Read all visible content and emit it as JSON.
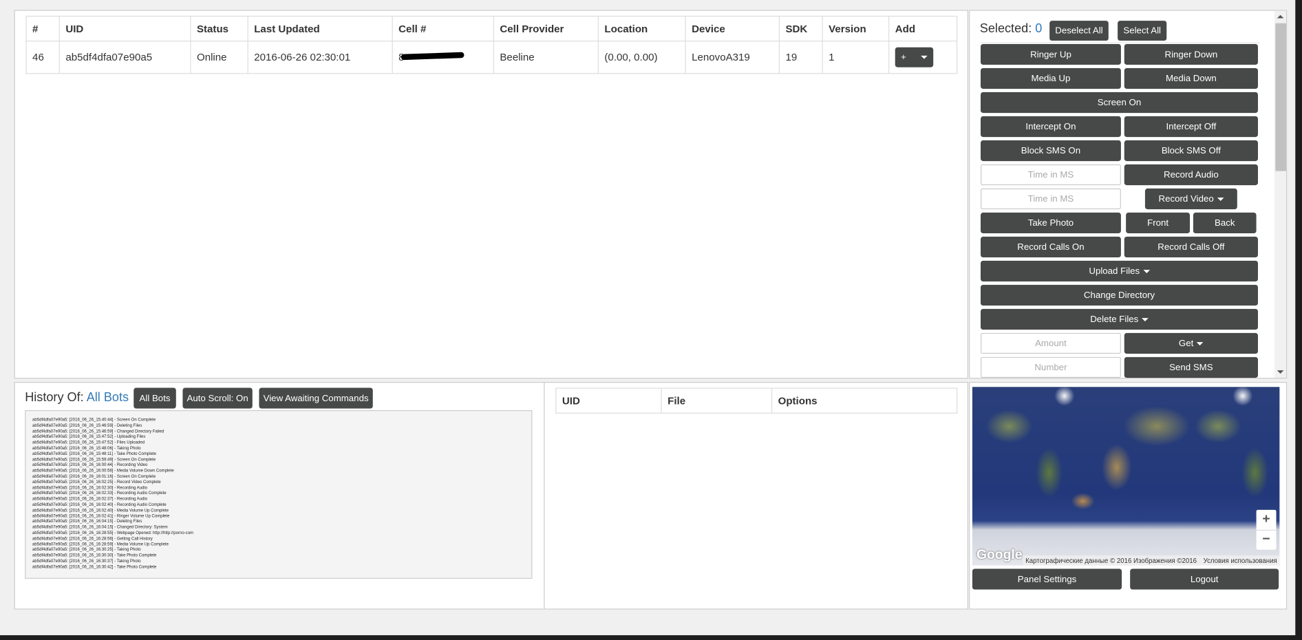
{
  "bots_table": {
    "headers": [
      "#",
      "UID",
      "Status",
      "Last Updated",
      "Cell #",
      "Cell Provider",
      "Location",
      "Device",
      "SDK",
      "Version",
      "Add"
    ],
    "rows": [
      {
        "num": "46",
        "uid": "ab5df4dfa07e90a5",
        "status": "Online",
        "last_updated": "2016-06-26 02:30:01",
        "cell": "8",
        "provider": "Beeline",
        "location": "(0.00, 0.00)",
        "device": "LenovoA319",
        "sdk": "19",
        "version": "1",
        "add": "+"
      }
    ]
  },
  "controls": {
    "selected_label": "Selected:",
    "selected_count": "0",
    "deselect_all": "Deselect All",
    "select_all": "Select All",
    "ringer_up": "Ringer Up",
    "ringer_down": "Ringer Down",
    "media_up": "Media Up",
    "media_down": "Media Down",
    "screen_on": "Screen On",
    "intercept_on": "Intercept On",
    "intercept_off": "Intercept Off",
    "block_sms_on": "Block SMS On",
    "block_sms_off": "Block SMS Off",
    "time_placeholder": "Time in MS",
    "record_audio": "Record Audio",
    "record_video": "Record Video",
    "take_photo": "Take Photo",
    "front": "Front",
    "back": "Back",
    "record_calls_on": "Record Calls On",
    "record_calls_off": "Record Calls Off",
    "upload_files": "Upload Files",
    "change_directory": "Change Directory",
    "delete_files": "Delete Files",
    "amount_placeholder": "Amount",
    "get": "Get",
    "number_placeholder": "Number",
    "send_sms": "Send SMS"
  },
  "history": {
    "title": "History Of:",
    "target": "All Bots",
    "all_bots": "All Bots",
    "auto_scroll": "Auto Scroll: On",
    "view_awaiting": "View Awaiting Commands",
    "log": [
      "ab5df4dfa07e90a5: [2016_06_26_15:40:44] - Screen On Complete",
      "ab5df4dfa07e90a5: [2016_06_26_15:46:59] - Deleting Files",
      "ab5df4dfa07e90a5: [2016_06_26_15:46:59] - Changed Directory Failed",
      "ab5df4dfa07e90a5: [2016_06_26_15:47:52] - Uploading Files",
      "ab5df4dfa07e90a5: [2016_06_26_15:47:52] - Files Uploaded",
      "ab5df4dfa07e90a5: [2016_06_26_15:48:06] - Taking Photo",
      "ab5df4dfa07e90a5: [2016_06_26_15:48:11] - Take Photo Complete",
      "ab5df4dfa07e90a5: [2016_06_26_15:59:49] - Screen On Complete",
      "ab5df4dfa07e90a5: [2016_06_26_16:00:44] - Recording Video",
      "ab5df4dfa07e90a5: [2016_06_26_16:00:56] - Media Volume Down Complete",
      "ab5df4dfa07e90a5: [2016_06_26_16:01:16] - Screen On Complete",
      "ab5df4dfa07e90a5: [2016_06_26_16:02:25] - Record Video Complete",
      "ab5df4dfa07e90a5: [2016_06_26_16:02:30] - Recording Audio",
      "ab5df4dfa07e90a5: [2016_06_26_16:02:33] - Recording Audio Complete",
      "ab5df4dfa07e90a5: [2016_06_26_16:02:37] - Recording Audio",
      "ab5df4dfa07e90a5: [2016_06_26_16:02:40] - Recording Audio Complete",
      "ab5df4dfa07e90a5: [2016_06_26_16:02:40] - Media Volume Up Complete",
      "ab5df4dfa07e90a5: [2016_06_26_16:02:41] - Ringer Volume Up Complete",
      "ab5df4dfa07e90a5: [2016_06_26_16:04:15] - Deleting Files",
      "ab5df4dfa07e90a5: [2016_06_26_16:04:15] - Changed Directory: System",
      "ab5df4dfa07e90a5: [2016_06_26_16:28:55] - Webpage Opened: http://http://porno-com",
      "ab5df4dfa07e90a5: [2016_06_26_16:28:56] - Getting Call History",
      "ab5df4dfa07e90a5: [2016_06_26_16:28:59] - Media Volume Up Complete",
      "ab5df4dfa07e90a5: [2016_06_26_16:30:25] - Taking Photo",
      "ab5df4dfa07e90a5: [2016_06_26_16:30:30] - Take Photo Complete",
      "ab5df4dfa07e90a5: [2016_06_26_16:30:37] - Taking Photo",
      "ab5df4dfa07e90a5: [2016_06_26_16:30:42] - Take Photo Complete"
    ]
  },
  "files_table": {
    "headers": [
      "UID",
      "File",
      "Options"
    ]
  },
  "map": {
    "logo": "Google",
    "attribution": "Картографические данные © 2016 Изображения ©2016",
    "terms": "Условия использования",
    "zoom_in": "+",
    "zoom_out": "−"
  },
  "footer": {
    "panel_settings": "Panel Settings",
    "logout": "Logout"
  },
  "colors": {
    "button": "#474949",
    "link": "#337ab7"
  }
}
